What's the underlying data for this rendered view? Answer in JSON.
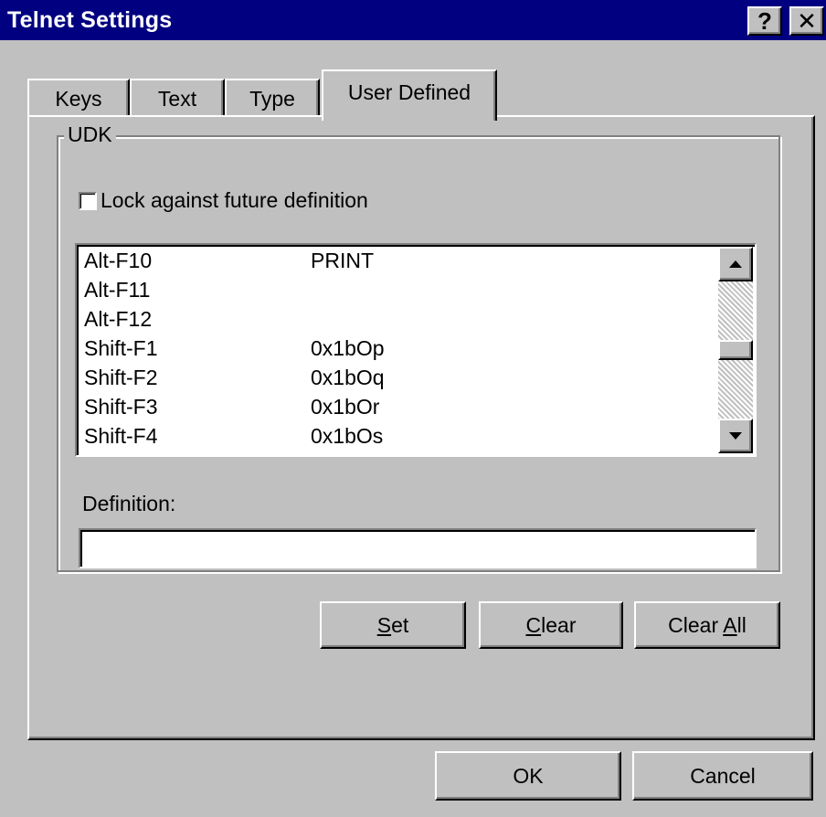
{
  "window": {
    "title": "Telnet Settings",
    "help_glyph": "?",
    "close_glyph": "✕"
  },
  "tabs": [
    {
      "label": "Keys",
      "active": false
    },
    {
      "label": "Text",
      "active": false
    },
    {
      "label": "Type",
      "active": false
    },
    {
      "label": "User Defined",
      "active": true
    }
  ],
  "udk": {
    "group_label": "UDK",
    "lock_label": "Lock against future definition",
    "lock_checked": false,
    "rows": [
      {
        "key": "Alt-F10",
        "value": "PRINT"
      },
      {
        "key": "Alt-F11",
        "value": ""
      },
      {
        "key": "Alt-F12",
        "value": ""
      },
      {
        "key": "Shift-F1",
        "value": "0x1bOp"
      },
      {
        "key": "Shift-F2",
        "value": "0x1bOq"
      },
      {
        "key": "Shift-F3",
        "value": "0x1bOr"
      },
      {
        "key": "Shift-F4",
        "value": "0x1bOs"
      }
    ],
    "definition_label": "Definition:",
    "definition_value": ""
  },
  "buttons": {
    "set": {
      "pre": "",
      "ul": "S",
      "post": "et"
    },
    "clear": {
      "pre": "",
      "ul": "C",
      "post": "lear"
    },
    "clear_all": {
      "pre": "Clear ",
      "ul": "A",
      "post": "ll"
    },
    "ok": "OK",
    "cancel": "Cancel"
  }
}
